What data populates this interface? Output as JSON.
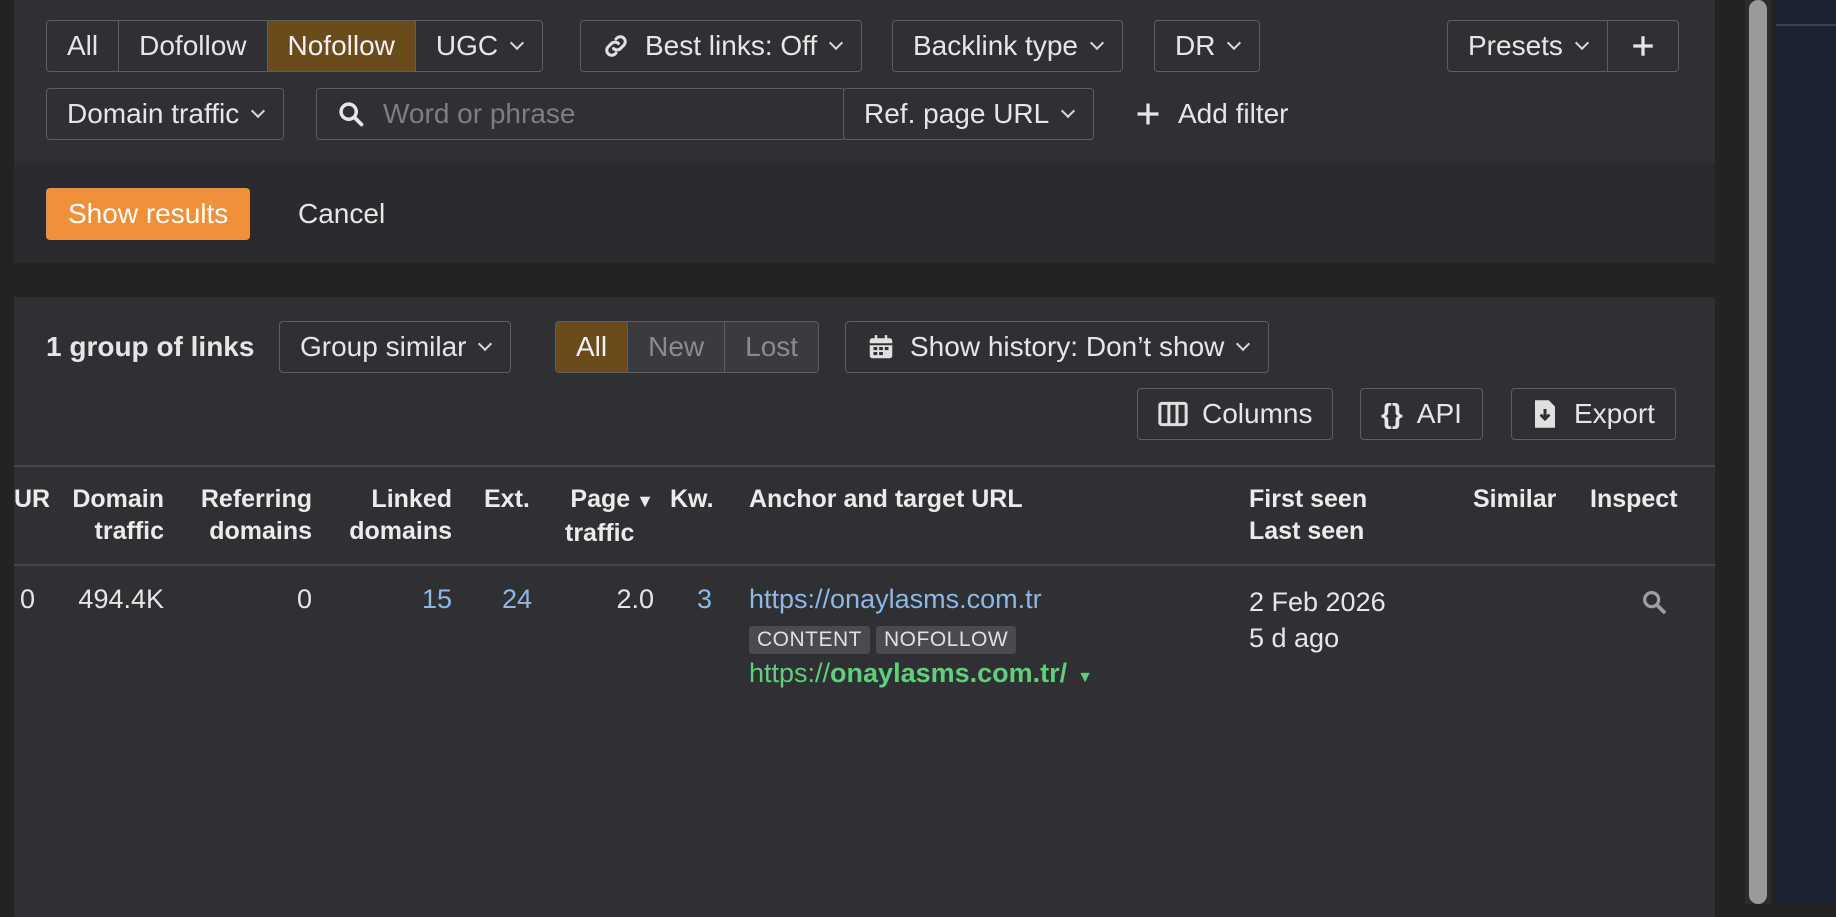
{
  "filters": {
    "link_type_tabs": [
      "All",
      "Dofollow",
      "Nofollow",
      "UGC"
    ],
    "best_links": "Best links: Off",
    "backlink_type": "Backlink type",
    "dr": "DR",
    "presets": "Presets",
    "domain_traffic": "Domain traffic",
    "search_placeholder": "Word or phrase",
    "ref_page_url": "Ref. page URL",
    "add_filter": "Add filter"
  },
  "actions": {
    "show_results": "Show results",
    "cancel": "Cancel"
  },
  "results": {
    "count_label": "1 group of links",
    "group_similar": "Group similar",
    "tabs": [
      "All",
      "New",
      "Lost"
    ],
    "show_history": "Show history: Don’t show",
    "columns": "Columns",
    "api": "API",
    "export": "Export"
  },
  "table": {
    "headers": {
      "ur": "UR",
      "domain_traffic_1": "Domain",
      "domain_traffic_2": "traffic",
      "ref_domains_1": "Referring",
      "ref_domains_2": "domains",
      "linked_domains_1": "Linked",
      "linked_domains_2": "domains",
      "ext": "Ext.",
      "page_traffic_1": "Page",
      "page_traffic_2": "traffic",
      "kw": "Kw.",
      "anchor": "Anchor and target URL",
      "first_seen": "First seen",
      "last_seen": "Last seen",
      "similar": "Similar",
      "inspect": "Inspect"
    },
    "row": {
      "ur": "0",
      "domain_traffic": "494.4K",
      "referring_domains": "0",
      "linked_domains": "15",
      "ext": "24",
      "page_traffic": "2.0",
      "kw": "3",
      "ref_url": "https://onaylasms.com.tr",
      "tags": [
        "CONTENT",
        "NOFOLLOW"
      ],
      "target_prefix": "https://",
      "target_bold": "onaylasms.com.tr/",
      "first_seen": "2 Feb 2026",
      "last_seen": "5 d ago"
    }
  },
  "colors": {
    "accent": "#f0913a",
    "active_tab": "#6b4a1c",
    "link": "#8cb8e6",
    "target": "#5fcf7a"
  }
}
